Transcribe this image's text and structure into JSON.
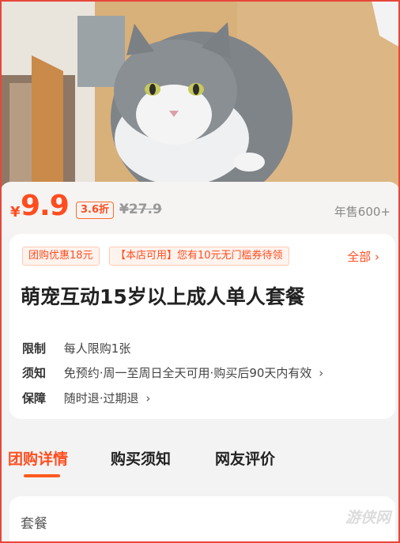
{
  "hero": {
    "image": "cat-photo"
  },
  "price": {
    "symbol": "¥",
    "value": "9.9",
    "discount": "3.6折",
    "original": "¥27.9",
    "annual_sales": "年售600+"
  },
  "coupons": {
    "group_discount": "团购优惠18元",
    "store_coupon": "【本店可用】您有10元无门槛券待领",
    "all_label": "全部 ›"
  },
  "product": {
    "title": "萌宠互动15岁以上成人单人套餐"
  },
  "details": {
    "limit_label": "限制",
    "limit_value": "每人限购1张",
    "notice_label": "须知",
    "notice_value": "免预约·周一至周日全天可用·购买后90天内有效",
    "guarantee_label": "保障",
    "guarantee_value": "随时退·过期退"
  },
  "tabs": [
    "团购详情",
    "购买须知",
    "网友评价"
  ],
  "package": {
    "label": "套餐"
  },
  "watermark": "游侠网",
  "colors": {
    "accent": "#ff4d1f",
    "frame": "#e8463a"
  }
}
